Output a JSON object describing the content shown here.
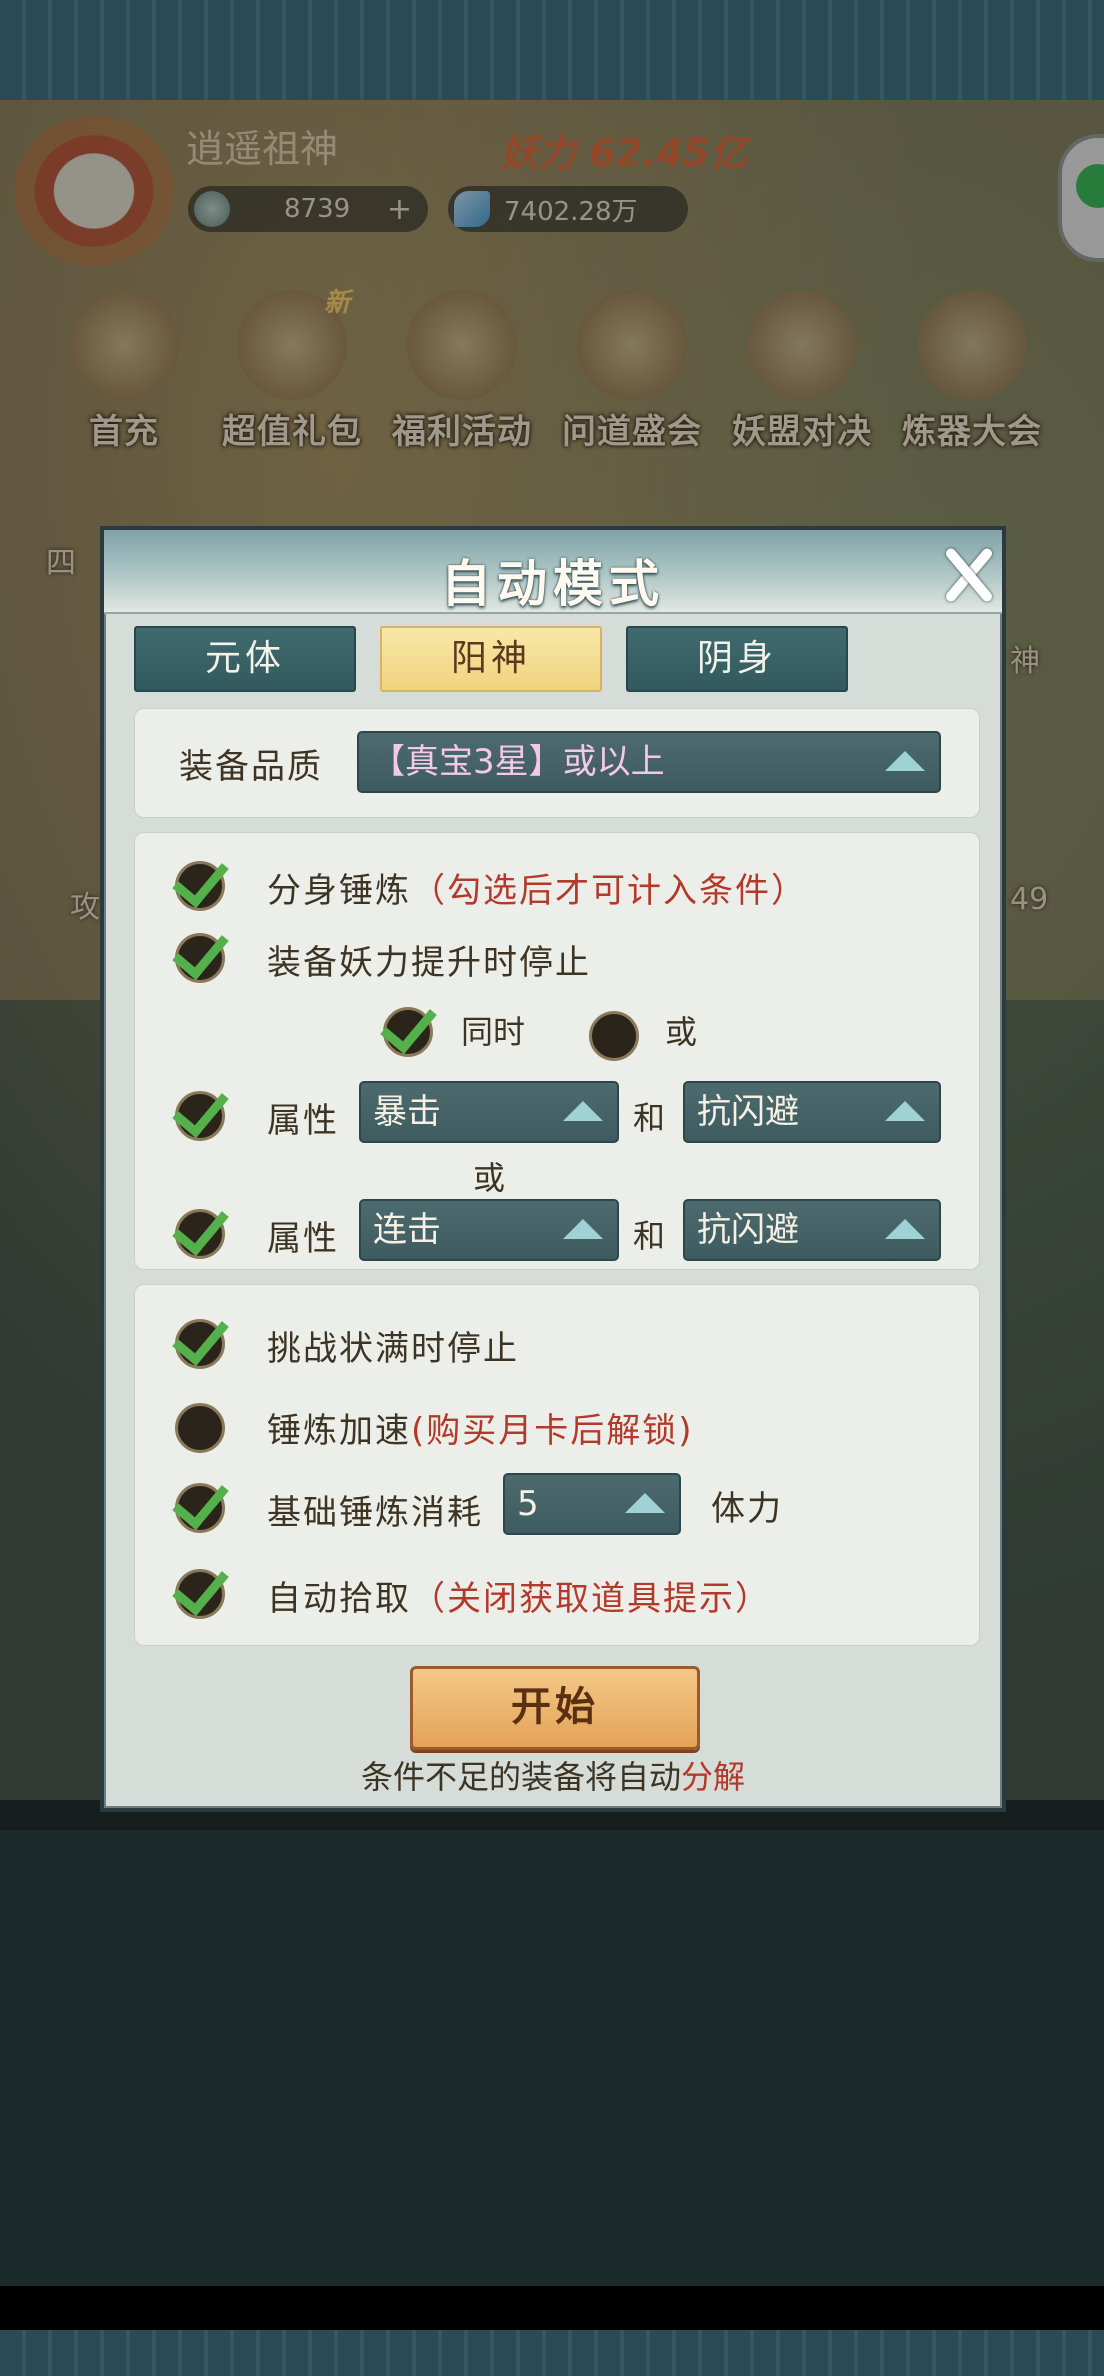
{
  "game": {
    "player_name": "逍遥祖神",
    "power": "妖力 62.45亿",
    "currency_silver": "8739",
    "currency_plus": "+",
    "currency_jade": "7402.28万",
    "menu": [
      {
        "label": "首充"
      },
      {
        "label": "超值礼包",
        "badge": "新"
      },
      {
        "label": "福利活动"
      },
      {
        "label": "问道盛会"
      },
      {
        "label": "妖盟对决"
      },
      {
        "label": "炼器大会"
      }
    ],
    "side_labels": {
      "left_top": "四",
      "right_top": "神",
      "left_mid": "攻",
      "right_mid": "49"
    }
  },
  "modal": {
    "title": "自动模式",
    "tabs": [
      {
        "label": "元体",
        "active": false
      },
      {
        "label": "阳神",
        "active": true
      },
      {
        "label": "阴身",
        "active": false
      }
    ],
    "quality": {
      "label": "装备品质",
      "value": "【真宝3星】或以上"
    },
    "options": {
      "clone_forge": {
        "label": "分身锤炼",
        "note": "（勾选后才可计入条件）",
        "checked": true
      },
      "stop_on_power": {
        "label": "装备妖力提升时停止",
        "checked": true
      },
      "mode_same": {
        "label": "同时",
        "checked": true
      },
      "mode_or": {
        "label": "或",
        "checked": false
      },
      "attr1": {
        "label": "属性",
        "value_a": "暴击",
        "joiner": "和",
        "value_b": "抗闪避",
        "checked": true
      },
      "or_text": "或",
      "attr2": {
        "label": "属性",
        "value_a": "连击",
        "joiner": "和",
        "value_b": "抗闪避",
        "checked": true
      }
    },
    "settings": {
      "stop_full": {
        "label": "挑战状满时停止",
        "checked": true
      },
      "speedup": {
        "label": "锤炼加速",
        "note": "(购买月卡后解锁)",
        "checked": false
      },
      "base_cost": {
        "label": "基础锤炼消耗",
        "value": "5",
        "unit": "体力",
        "checked": true
      },
      "auto_pick": {
        "label": "自动拾取",
        "note": "（关闭获取道具提示）",
        "checked": true
      }
    },
    "start_label": "开始",
    "footer_text": "条件不足的装备将自动",
    "footer_highlight": "分解"
  },
  "colors": {
    "accent_green": "#54b04a",
    "warning_red": "#b33a2a",
    "tab_active": "#f0d37e",
    "dropdown": "#4d6b6f"
  }
}
